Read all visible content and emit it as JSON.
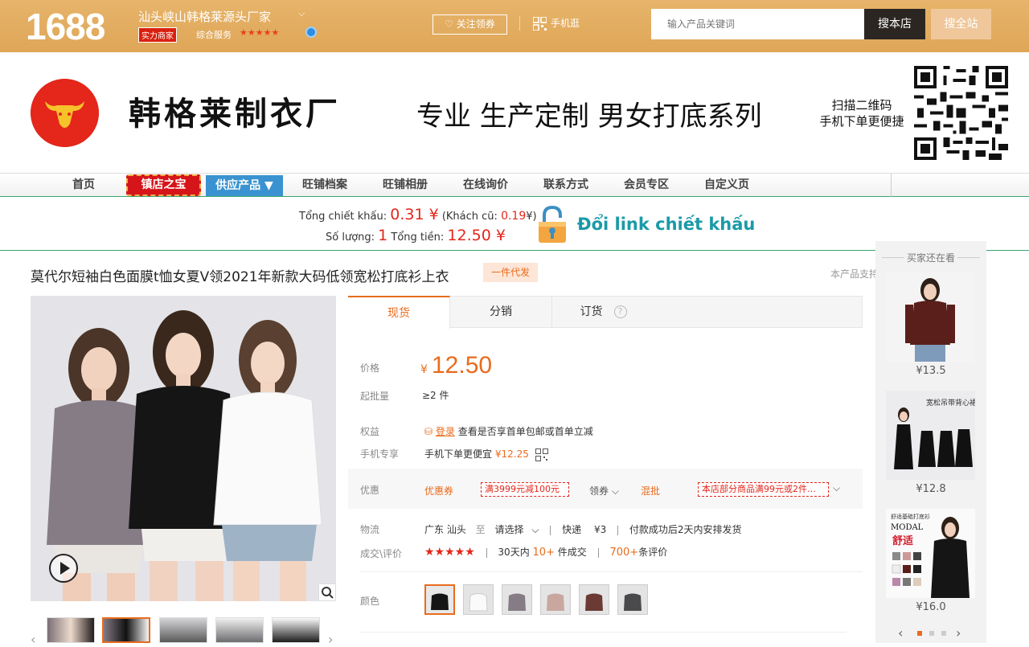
{
  "topbar": {
    "logo": "1688",
    "shop_name": "汕头峡山韩格莱源头厂家",
    "shop_caret": "⌵",
    "badge_strength": "实力商家",
    "service_label": "综合服务",
    "service_stars": "★★★★★",
    "follow_label": "关注领券",
    "mobile_label": "手机逛",
    "search_placeholder": "输入产品关键词",
    "search_shop_label": "搜本店",
    "search_all_label": "搜全站"
  },
  "banner": {
    "brand_title": "韩格莱制衣厂",
    "slogan": "专业 生产定制 男女打底系列",
    "qr_tip_line1": "扫描二维码",
    "qr_tip_line2": "手机下单更便捷"
  },
  "nav": {
    "home": "首页",
    "treasure": "镇店之宝",
    "supply": "供应产品 ▼",
    "archive": "旺铺档案",
    "album": "旺铺相册",
    "inquiry": "在线询价",
    "contact": "联系方式",
    "member": "会员专区",
    "custom": "自定义页"
  },
  "discount": {
    "total_discount_label": "Tổng chiết khấu:",
    "total_discount_value": "0.31 ¥",
    "old_label_open": "(Khách cũ:",
    "old_value": "0.19",
    "old_label_close": "¥)",
    "quantity_label": "Số lượng:",
    "quantity_value": "1",
    "total_label": "Tổng tiền:",
    "total_value": "12.50 ¥",
    "link_text": "Đổi link chiết khấu"
  },
  "product": {
    "title": "莫代尔短袖白色面膜t恤女夏V领2021年新款大码低领宽松打底衫上衣",
    "proxy_tag": "一件代发",
    "support_text": "本产品支持"
  },
  "tabs": [
    "现货",
    "分销",
    "订货"
  ],
  "help_icon_glyph": "?",
  "details": {
    "price_label": "价格",
    "price_currency": "¥",
    "price_value": "12.50",
    "moq_label": "起批量",
    "moq_value": "≥2 件",
    "benefit_label": "权益",
    "benefit_login": "登录",
    "benefit_text": "查看是否享首单包邮或首单立减",
    "mobile_label": "手机专享",
    "mobile_text": "手机下单更便宜",
    "mobile_price": "¥12.25",
    "promo_label": "优惠",
    "promo_coupon_label": "优惠券",
    "promo_coupon_tag": "满3999元减100元",
    "promo_claim": "领券",
    "promo_mix_label": "混批",
    "promo_mix_tag": "本店部分商品满99元或2件…",
    "logistics_label": "物流",
    "logistics_from": "广东 汕头",
    "logistics_to": "至",
    "logistics_select": "请选择",
    "logistics_express": "快递",
    "logistics_fee": "¥3",
    "logistics_ship": "付款成功后2天内安排发货",
    "deal_label": "成交\\评价",
    "deal_stars": "★★★★★",
    "deal_30days": "30天内",
    "deal_count": "10+",
    "deal_unit": "件成交",
    "review_count": "700+",
    "review_unit": "条评价",
    "color_label": "颜色"
  },
  "sidebar": {
    "title": "买家还在看",
    "items": [
      {
        "price": "¥13.5"
      },
      {
        "price": "¥12.8",
        "caption": "宽松吊带背心裙"
      },
      {
        "price": "¥16.0",
        "caption": "舒适基础打底衫",
        "sub": "MODAL",
        "hand": "舒适"
      }
    ]
  },
  "colors": {
    "accent_orange": "#e96b1d",
    "brand_red": "#e4261b",
    "topbar_gold": "#e1aa5e",
    "link_teal": "#1b9aa8"
  }
}
